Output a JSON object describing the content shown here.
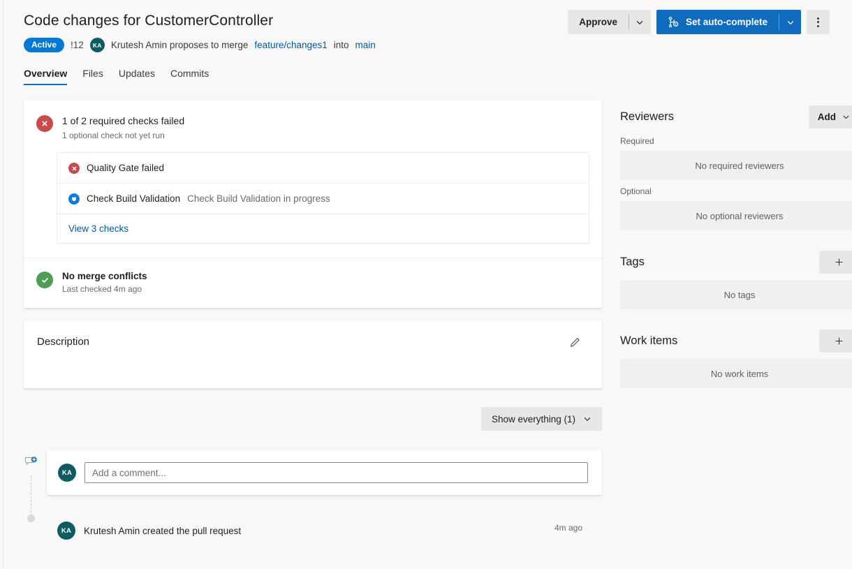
{
  "header": {
    "title": "Code changes for CustomerController",
    "status_badge": "Active",
    "pr_id": "!12",
    "author_initials": "KA",
    "proposes_text": "Krutesh Amin proposes to merge",
    "source_branch": "feature/changes1",
    "into_text": "into",
    "target_branch": "main"
  },
  "actions": {
    "approve_label": "Approve",
    "auto_complete_label": "Set auto-complete",
    "caret_icon": "chevron-down-icon",
    "auto_complete_icon": "branch-gear-icon",
    "more_icon": "more-vertical-icon",
    "primary_color": "#0f6cbd",
    "secondary_color": "#e7e7e7"
  },
  "tabs": [
    {
      "label": "Overview",
      "active": true
    },
    {
      "label": "Files",
      "active": false
    },
    {
      "label": "Updates",
      "active": false
    },
    {
      "label": "Commits",
      "active": false
    }
  ],
  "checks": {
    "summary_title": "1 of 2 required checks failed",
    "summary_sub": "1 optional check not yet run",
    "summary_icon": "error-circle-icon",
    "summary_color": "#c94a4d",
    "rows": [
      {
        "icon": "error-circle-icon",
        "icon_color": "#c94a4d",
        "name": "Quality Gate failed",
        "status": ""
      },
      {
        "icon": "in-progress-circle-icon",
        "icon_color": "#0f7bd4",
        "name": "Check Build Validation",
        "status": "Check Build Validation in progress"
      }
    ],
    "view_link": "View 3 checks"
  },
  "merge": {
    "title": "No merge conflicts",
    "sub": "Last checked 4m ago",
    "icon": "checkmark-circle-icon",
    "color": "#4f9c53"
  },
  "description": {
    "title": "Description",
    "edit_icon": "pencil-icon"
  },
  "filter": {
    "label": "Show everything (1)",
    "caret_icon": "chevron-down-icon"
  },
  "activity": {
    "rail_icon": "comment-add-icon",
    "comment_avatar": "KA",
    "comment_placeholder": "Add a comment...",
    "comment_value": "",
    "entries": [
      {
        "avatar": "KA",
        "text": "Krutesh Amin created the pull request",
        "time": "4m ago"
      }
    ]
  },
  "sidebar": {
    "reviewers": {
      "title": "Reviewers",
      "add_label": "Add",
      "add_caret_icon": "chevron-down-icon",
      "required_label": "Required",
      "required_empty": "No required reviewers",
      "optional_label": "Optional",
      "optional_empty": "No optional reviewers"
    },
    "tags": {
      "title": "Tags",
      "add_icon": "plus-icon",
      "empty": "No tags"
    },
    "work_items": {
      "title": "Work items",
      "add_icon": "plus-icon",
      "empty": "No work items"
    }
  }
}
